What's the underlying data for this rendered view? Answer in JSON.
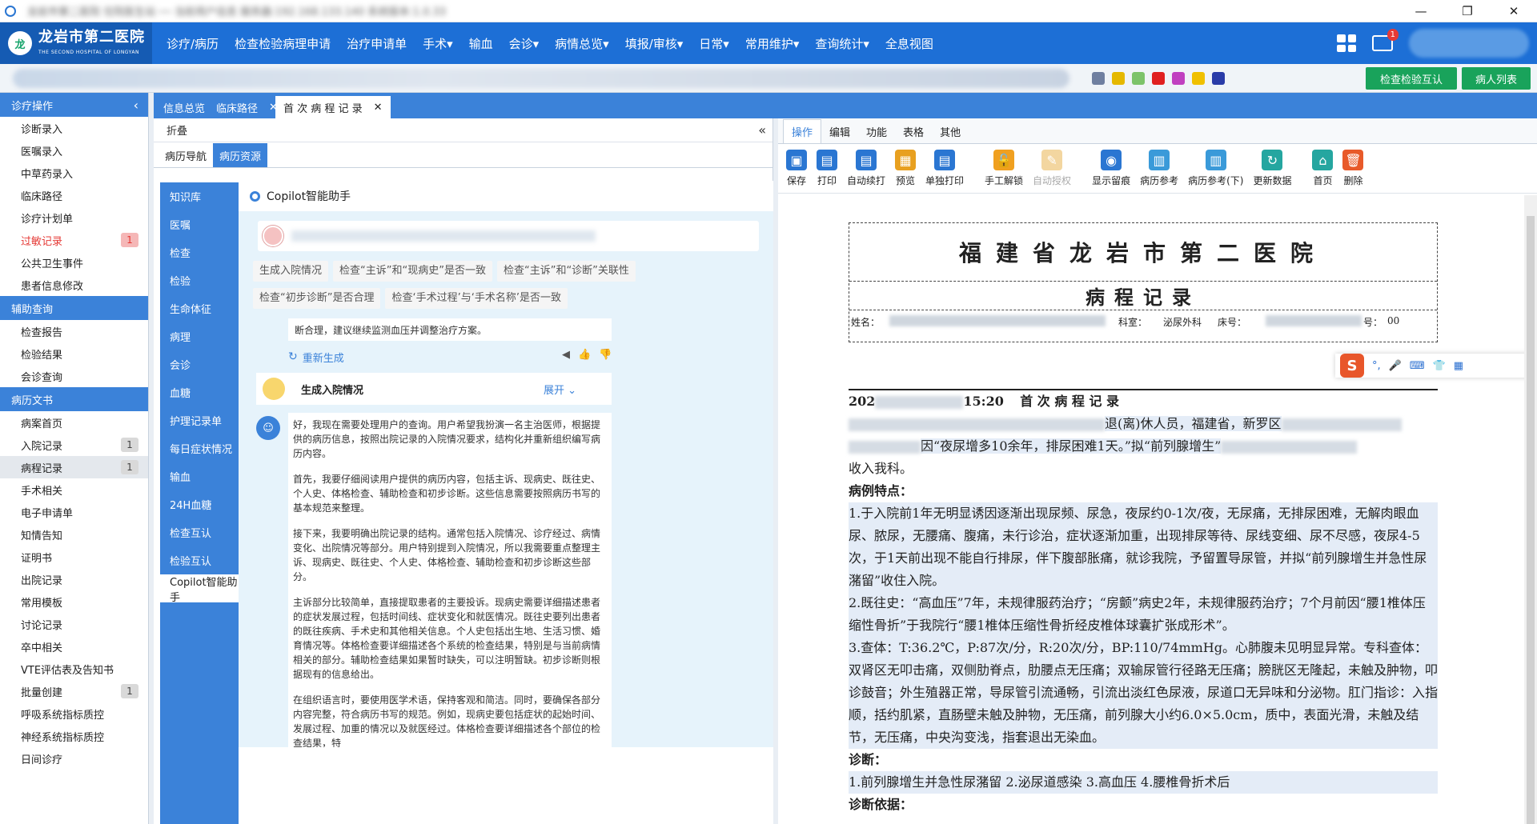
{
  "window": {
    "title": "龙岩市第二医院 住院医生站 ── 当前用户信息 服务器:192.168.133.140 系统版本:1.0.33",
    "controls": [
      "—",
      "❐",
      "✕"
    ]
  },
  "logo": {
    "name": "龙岩市第二医院",
    "en": "THE SECOND HOSPITAL OF LONGYAN",
    "mark": "龙"
  },
  "menu": [
    "诊疗/病历",
    "检查检验病理申请",
    "治疗申请单",
    "手术▾",
    "输血",
    "会诊▾",
    "病情总览▾",
    "填报/审核▾",
    "日常▾",
    "常用维护▾",
    "查询统计▾",
    "全息视图"
  ],
  "mail_badge": "1",
  "toolbar": {
    "btn1": "检查检验互认",
    "btn2": "病人列表",
    "icon_colors": [
      "#6f7fa0",
      "#e5b800",
      "#7cc36a",
      "#e02020",
      "#c040c0",
      "#f0c000",
      "#2a3ca8"
    ]
  },
  "sidebar": {
    "groups": [
      {
        "title": "诊疗操作",
        "items": [
          {
            "label": "诊断录入"
          },
          {
            "label": "医嘱录入"
          },
          {
            "label": "中草药录入"
          },
          {
            "label": "临床路径"
          },
          {
            "label": "诊疗计划单"
          },
          {
            "label": "过敏记录",
            "count": "1",
            "red": true
          },
          {
            "label": "公共卫生事件"
          },
          {
            "label": "患者信息修改"
          }
        ]
      },
      {
        "title": "辅助查询",
        "items": [
          {
            "label": "检查报告"
          },
          {
            "label": "检验结果"
          },
          {
            "label": "会诊查询"
          }
        ]
      },
      {
        "title": "病历文书",
        "items": [
          {
            "label": "病案首页"
          },
          {
            "label": "入院记录",
            "count": "1"
          },
          {
            "label": "病程记录",
            "count": "1",
            "active": true
          },
          {
            "label": "手术相关"
          },
          {
            "label": "电子申请单"
          },
          {
            "label": "知情告知"
          },
          {
            "label": "证明书"
          },
          {
            "label": "出院记录"
          },
          {
            "label": "常用模板"
          },
          {
            "label": "讨论记录"
          },
          {
            "label": "卒中相关"
          },
          {
            "label": "VTE评估表及告知书"
          },
          {
            "label": "批量创建",
            "count": "1"
          },
          {
            "label": "呼吸系统指标质控"
          },
          {
            "label": "神经系统指标质控"
          },
          {
            "label": "日间诊疗"
          }
        ]
      }
    ]
  },
  "tabs": [
    {
      "label": "信息总览"
    },
    {
      "label": "临床路径",
      "close": "✕"
    },
    {
      "label": "首 次 病 程 记 录",
      "close": "✕"
    }
  ],
  "left": {
    "fold": "折叠",
    "fold_icon": "«",
    "subtabs": [
      "病历导航",
      "病历资源"
    ],
    "vnav": [
      "知识库",
      "医嘱",
      "检查",
      "检验",
      "生命体征",
      "病理",
      "会诊",
      "血糖",
      "护理记录单",
      "每日症状情况",
      "输血",
      "24H血糖",
      "检查互认",
      "检验互认",
      "Copilot智能助手"
    ],
    "copilot": {
      "title": "Copilot智能助手",
      "chips": [
        "生成入院情况",
        "检查“主诉”和“现病史”是否一致",
        "检查“主诉”和“诊断”关联性",
        "检查“初步诊断”是否合理",
        "检查‘手术过程’与‘手术名称’是否一致"
      ],
      "prev_line": "断合理，建议继续监测血压并调整治疗方案。",
      "regen": "重新生成",
      "expand_title": "生成入院情况",
      "expand_btn": "展开",
      "answer": [
        "好，我现在需要处理用户的查询。用户希望我扮演一名主治医师，根据提供的病历信息，按照出院记录的入院情况要求，结构化并重新组织编写病历内容。",
        "首先，我要仔细阅读用户提供的病历内容，包括主诉、现病史、既往史、个人史、体格检查、辅助检查和初步诊断。这些信息需要按照病历书写的基本规范来整理。",
        "接下来，我要明确出院记录的结构。通常包括入院情况、诊疗经过、病情变化、出院情况等部分。用户特别提到入院情况，所以我需要重点整理主诉、现病史、既往史、个人史、体格检查、辅助检查和初步诊断这些部分。",
        "主诉部分比较简单，直接提取患者的主要投诉。现病史需要详细描述患者的症状发展过程，包括时间线、症状变化和就医情况。既往史要列出患者的既往疾病、手术史和其他相关信息。个人史包括出生地、生活习惯、婚育情况等。体格检查要详细描述各个系统的检查结果，特别是与当前病情相关的部分。辅助检查结果如果暂时缺失，可以注明暂缺。初步诊断则根据现有的信息给出。",
        "在组织语言时，要使用医学术语，保持客观和简洁。同时，要确保各部分内容完整，符合病历书写的规范。例如，现病史要包括症状的起始时间、发展过程、加重的情况以及就医经过。体格检查要详细描述各个部位的检查结果，特"
      ]
    }
  },
  "right": {
    "tabs": [
      "操作",
      "编辑",
      "功能",
      "表格",
      "其他"
    ],
    "ribbon": [
      {
        "label": "保存",
        "icon": "save-icon",
        "color": "#2a76d2",
        "glyph": "▣"
      },
      {
        "label": "打印",
        "icon": "print-icon",
        "color": "#2a76d2",
        "glyph": "▤"
      },
      {
        "label": "自动续打",
        "icon": "auto-print-icon",
        "color": "#2a76d2",
        "glyph": "▤"
      },
      {
        "label": "预览",
        "icon": "preview-icon",
        "color": "#e8a020",
        "glyph": "▦"
      },
      {
        "label": "单独打印",
        "icon": "single-print-icon",
        "color": "#2a76d2",
        "glyph": "▤"
      },
      {
        "label": "手工解锁",
        "icon": "unlock-icon",
        "color": "#f0a020",
        "glyph": "🔓"
      },
      {
        "label": "自动授权",
        "icon": "authorize-icon",
        "color": "#f3d6a0",
        "glyph": "✎",
        "dim": true
      },
      {
        "label": "显示留痕",
        "icon": "eye-icon",
        "color": "#2a76d2",
        "glyph": "◉"
      },
      {
        "label": "病历参考",
        "icon": "reference-icon",
        "color": "#3a9ad9",
        "glyph": "▥"
      },
      {
        "label": "病历参考(下)",
        "icon": "reference-down-icon",
        "color": "#3a9ad9",
        "glyph": "▥"
      },
      {
        "label": "更新数据",
        "icon": "refresh-icon",
        "color": "#25a6a0",
        "glyph": "↻"
      },
      {
        "label": "首页",
        "icon": "home-icon",
        "color": "#25a6a0",
        "glyph": "⌂"
      },
      {
        "label": "删除",
        "icon": "delete-icon",
        "color": "#e85a2a",
        "glyph": "🗑"
      }
    ],
    "doc": {
      "hospital": "福建省龙岩市第二医院",
      "title": "病程记录",
      "info": {
        "name_label": "姓名：",
        "dept_label": "科室：",
        "dept": "泌尿外科",
        "bed_label": "床号：",
        "no_label": "号：",
        "no": "00"
      },
      "date_prefix": "202",
      "time": "15:20",
      "first_title": "首 次 病 程 记 录",
      "line1": "退(离)休人员，福建省，新罗区",
      "line2a": "因“夜尿增多10余年，排尿困难1天。”拟“前列腺增生”",
      "line3": "收入我科。",
      "h1": "病例特点：",
      "p1": "1.于入院前1年无明显诱因逐渐出现尿频、尿急，夜尿约0-1次/夜，无尿痛，无排尿困难，无解肉眼血尿、脓尿，无腰痛、腹痛，未行诊治，症状逐渐加重，出现排尿等待、尿线变细、尿不尽感，夜尿4-5次，于1天前出现不能自行排尿，伴下腹部胀痛，就诊我院，予留置导尿管，并拟“前列腺增生并急性尿潴留”收住入院。",
      "p2": "2.既往史：“高血压”7年，未规律服药治疗；“房颤”病史2年，未规律服药治疗；7个月前因“腰1椎体压缩性骨折”于我院行“腰1椎体压缩性骨折经皮椎体球囊扩张成形术”。",
      "p3": "3.查体：T:36.2℃，P:87次/分，R:20次/分，BP:110/74mmHg。心肺腹未见明显异常。专科查体：双肾区无叩击痛，双侧肋脊点，肋腰点无压痛；双输尿管行径路无压痛；膀胱区无隆起，未触及肿物，叩诊鼓音；外生殖器正常，导尿管引流通畅，引流出淡红色尿液，尿道口无异味和分泌物。肛门指诊：入指顺，括约肌紧，直肠壁未触及肿物，无压痛，前列腺大小约6.0×5.0cm，质中，表面光滑，未触及结节，无压痛，中央沟变浅，指套退出无染血。",
      "h2": "诊断：",
      "p4": "1.前列腺增生并急性尿潴留 2.泌尿道感染 3.高血压 4.腰椎骨折术后",
      "h3": "诊断依据："
    }
  }
}
